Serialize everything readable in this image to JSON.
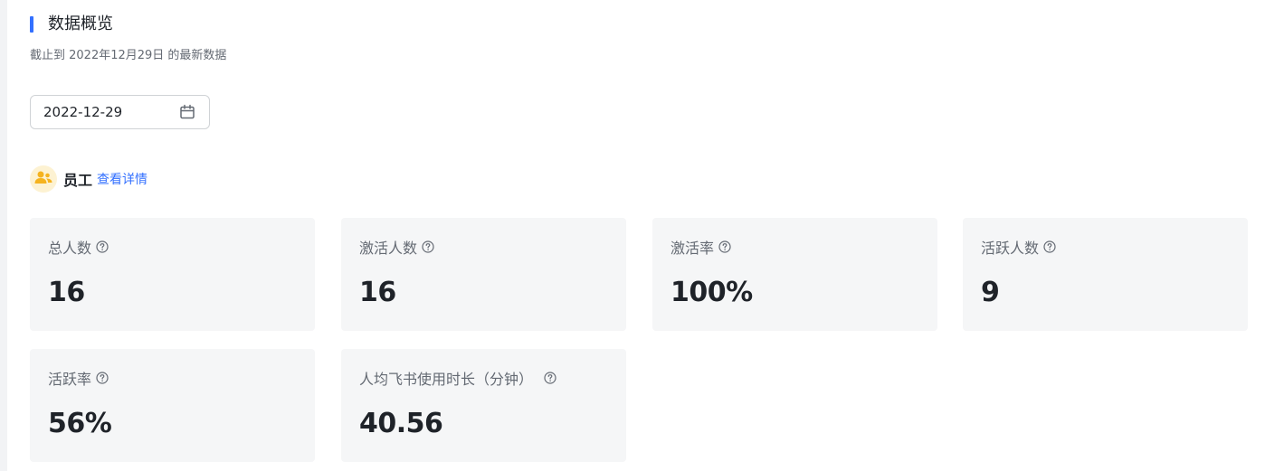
{
  "section": {
    "title": "数据概览",
    "subtitle": "截止到 2022年12月29日 的最新数据"
  },
  "date_picker": {
    "value": "2022-12-29",
    "icon": "calendar-icon"
  },
  "employee": {
    "label": "员工",
    "link": "查看详情",
    "icon": "people-icon"
  },
  "metrics": [
    {
      "label": "总人数",
      "value": "16"
    },
    {
      "label": "激活人数",
      "value": "16"
    },
    {
      "label": "激活率",
      "value": "100%"
    },
    {
      "label": "活跃人数",
      "value": "9"
    },
    {
      "label": "活跃率",
      "value": "56%"
    },
    {
      "label": "人均飞书使用时长（分钟）",
      "value": "40.56"
    }
  ],
  "colors": {
    "accent": "#3370ff",
    "card_bg": "#f5f6f7",
    "avatar_bg": "#fdf2d2",
    "avatar_icon": "#f5b31f"
  }
}
